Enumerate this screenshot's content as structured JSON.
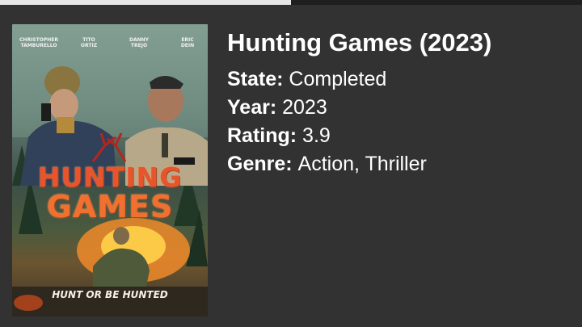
{
  "video": {
    "progress": 0.5
  },
  "poster": {
    "cast": [
      "CHRISTOPHER TAMBURELLO",
      "TITO ORTIZ",
      "DANNY TREJO",
      "ERIC DEIN"
    ],
    "title_line1": "HUNTING",
    "title_line2": "GAMES",
    "tagline": "HUNT OR BE HUNTED"
  },
  "movie": {
    "title": "Hunting Games (2023)",
    "state_label": "State:",
    "state_value": "Completed",
    "year_label": "Year:",
    "year_value": "2023",
    "rating_label": "Rating:",
    "rating_value": "3.9",
    "genre_label": "Genre:",
    "genre_value": "Action, Thriller"
  },
  "colors": {
    "background": "#323232",
    "text": "#ffffff",
    "poster_title": "#e8552c"
  }
}
